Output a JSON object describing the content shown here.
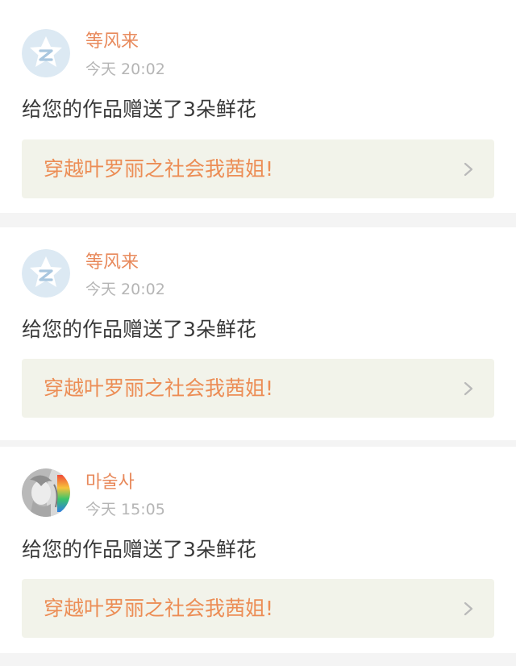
{
  "colors": {
    "page_background": "#f4f4f4",
    "card_background": "#ffffff",
    "name": "#e8895b",
    "time": "#b5b5b5",
    "message": "#3a3a3a",
    "link_background": "#f2f3ea",
    "link_text": "#ec8d55",
    "chevron": "#b9b9b9"
  },
  "notifications": [
    {
      "avatar": "default-star-z-avatar",
      "name": "等风来",
      "time": "今天 20:02",
      "message": "给您的作品赠送了3朵鲜花",
      "work_title": "穿越叶罗丽之社会我茜姐!"
    },
    {
      "avatar": "default-star-z-avatar",
      "name": "等风来",
      "time": "今天 20:02",
      "message": "给您的作品赠送了3朵鲜花",
      "work_title": "穿越叶罗丽之社会我茜姐!"
    },
    {
      "avatar": "anime-character-avatar",
      "name": "마술사",
      "time": "今天 15:05",
      "message": "给您的作品赠送了3朵鲜花",
      "work_title": "穿越叶罗丽之社会我茜姐!"
    }
  ]
}
